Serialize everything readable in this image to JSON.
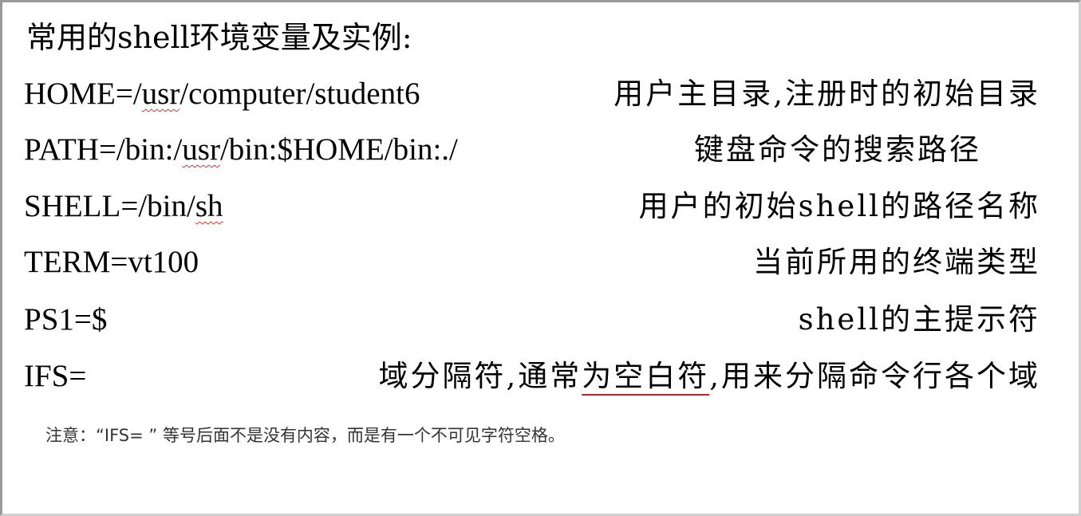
{
  "heading": "常用的shell环境变量及实例:",
  "rows": [
    {
      "code_pre": "HOME=/",
      "code_squig": "usr",
      "code_post": "/computer/student6",
      "desc": "用户主目录,注册时的初始目录"
    },
    {
      "code_pre": "PATH=/bin:/",
      "code_squig": "usr",
      "code_post": "/bin:$HOME/bin:./",
      "desc": "键盘命令的搜索路径"
    },
    {
      "code_pre": "SHELL=/bin/",
      "code_squig": "sh",
      "code_post": "",
      "desc": "用户的初始shell的路径名称"
    },
    {
      "code": "TERM=vt100",
      "desc": "当前所用的终端类型"
    },
    {
      "code": "PS1=$",
      "desc": "shell的主提示符"
    },
    {
      "code": "IFS=",
      "desc_pre": "域分隔符,通常",
      "desc_underlined": "为空白符",
      "desc_post": ",用来分隔命令行各个域"
    }
  ],
  "note": "注意：“IFS= ” 等号后面不是没有内容，而是有一个不可见字符空格。"
}
